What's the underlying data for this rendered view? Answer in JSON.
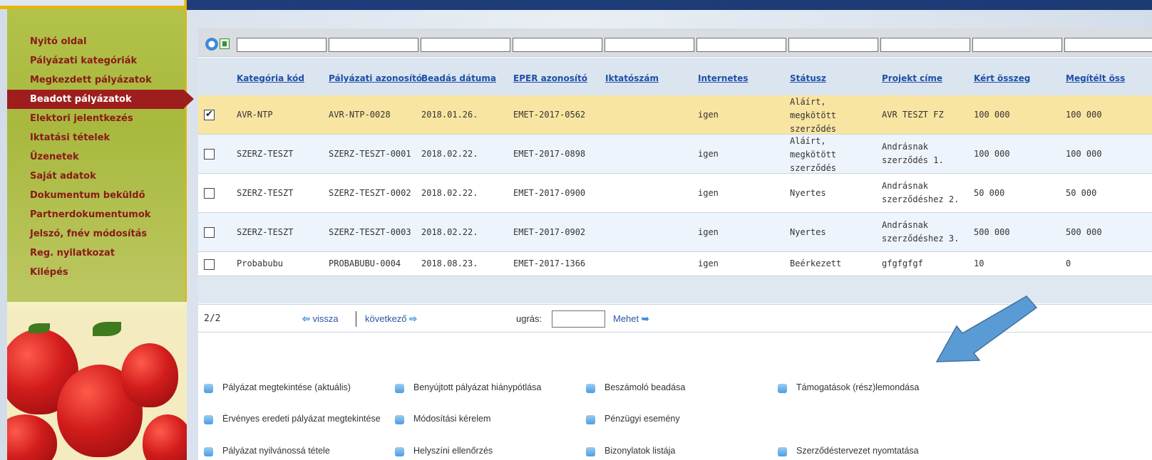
{
  "sidebar": {
    "items": [
      {
        "label": "Nyitó oldal"
      },
      {
        "label": "Pályázati kategóriák"
      },
      {
        "label": "Megkezdett pályázatok"
      },
      {
        "label": "Beadott pályázatok",
        "active": true
      },
      {
        "label": "Elektori jelentkezés"
      },
      {
        "label": "Iktatási tételek"
      },
      {
        "label": "Üzenetek"
      },
      {
        "label": "Saját adatok"
      },
      {
        "label": "Dokumentum beküldő"
      },
      {
        "label": "Partnerdokumentumok"
      },
      {
        "label": "Jelszó, fnév módosítás"
      },
      {
        "label": "Reg. nyilatkozat"
      },
      {
        "label": "Kilépés"
      }
    ]
  },
  "table": {
    "headers": [
      "Kategória kód",
      "Pályázati azonosító",
      "Beadás dátuma",
      "EPER azonosító",
      "Iktatószám",
      "Internetes",
      "Státusz",
      "Projekt címe",
      "Kért összeg",
      "Megítélt öss"
    ],
    "rows": [
      {
        "checked": true,
        "cells": [
          "AVR-NTP",
          "AVR-NTP-0028",
          "2018.01.26.",
          "EMET-2017-0562",
          "",
          "igen",
          "Aláírt, megkötött szerződés",
          "AVR TESZT FZ",
          "100 000",
          "100 000"
        ]
      },
      {
        "checked": false,
        "cells": [
          "SZERZ-TESZT",
          "SZERZ-TESZT-0001",
          "2018.02.22.",
          "EMET-2017-0898",
          "",
          "igen",
          "Aláírt, megkötött szerződés",
          "Andrásnak szerződés 1.",
          "100 000",
          "100 000"
        ]
      },
      {
        "checked": false,
        "cells": [
          "SZERZ-TESZT",
          "SZERZ-TESZT-0002",
          "2018.02.22.",
          "EMET-2017-0900",
          "",
          "igen",
          "Nyertes",
          "Andrásnak szerződéshez 2.",
          "50 000",
          "50 000"
        ]
      },
      {
        "checked": false,
        "cells": [
          "SZERZ-TESZT",
          "SZERZ-TESZT-0003",
          "2018.02.22.",
          "EMET-2017-0902",
          "",
          "igen",
          "Nyertes",
          "Andrásnak szerződéshez 3.",
          "500 000",
          "500 000"
        ]
      },
      {
        "checked": false,
        "cells": [
          "Probabubu",
          "PROBABUBU-0004",
          "2018.08.23.",
          "EMET-2017-1366",
          "",
          "igen",
          "Beérkezett",
          "gfgfgfgf",
          "10",
          "0"
        ]
      }
    ]
  },
  "pager": {
    "page": "2/2",
    "prev": "vissza",
    "next": "következő",
    "goto_label": "ugrás:",
    "goto_value": "",
    "go_button": "Mehet"
  },
  "actions": {
    "row1": [
      "Pályázat megtekintése (aktuális)",
      "Benyújtott pályázat hiánypótlása",
      "Beszámoló beadása",
      "Támogatások (rész)lemondása"
    ],
    "row2": [
      "Érvényes eredeti pályázat megtekintése",
      "Módosítási kérelem",
      "Pénzügyi esemény"
    ],
    "row3": [
      "Pályázat nyilvánossá tétele",
      "Helyszíni ellenőrzés",
      "Bizonylatok listája",
      "Szerződéstervezet nyomtatása"
    ]
  },
  "colors": {
    "menu_text": "#8a1a1a",
    "active_item": "#9e1e1e",
    "header_link": "#1e4fa8",
    "selected_row": "#f9e5a2",
    "annotation_arrow": "#5b9bd5"
  }
}
